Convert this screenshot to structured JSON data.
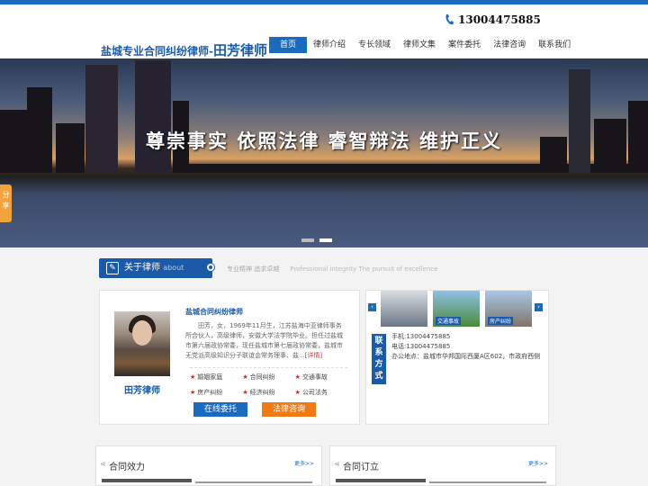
{
  "header": {
    "logo_text": "盐城专业合同纠纷律师-",
    "logo_name": "田芳律师",
    "phone": "13004475885"
  },
  "nav": {
    "items": [
      "首页",
      "律师介绍",
      "专长领域",
      "律师文集",
      "案件委托",
      "法律咨询",
      "联系我们"
    ],
    "active_index": 0
  },
  "banner": {
    "slogan": "尊崇事实  依照法律  睿智辩法  维护正义",
    "slide_count": 2,
    "active_slide": 1
  },
  "share": {
    "label": "分享"
  },
  "about": {
    "title": "关于律师",
    "title_en": "about",
    "motto": "专业精神 追求卓越",
    "motto_en": "Professional integrity The pursuit of excellence"
  },
  "lawyer": {
    "name": "田芳律师",
    "intro_title": "盐城合同纠纷律师",
    "intro_text": "田芳，女，1969年11月生，江苏盐海中亚律师事务所合伙人，高级律师，安徽大学法学院毕业。担任过盐城市第六届政协常委，现任盐城市第七届政协常委，盐城市无党派高级知识分子联谊会常务理事、盐...",
    "detail_link": "[详情]",
    "tags": [
      "婚姻家庭",
      "合同纠纷",
      "交通事故",
      "房产纠纷",
      "经济纠纷",
      "公司法务"
    ],
    "entrust_button": "在线委托",
    "consult_button": "法律咨询"
  },
  "contact": {
    "label": "联系方式",
    "thumbs": [
      "",
      "交通事故",
      "房产纠纷"
    ],
    "mobile": "手机:13004475885",
    "tel": "电话:13004475885",
    "address": "办公地点：盐城市华邦国际西厦A区602，市政府西侧"
  },
  "sections": [
    {
      "title": "合同效力",
      "more": "更多>>"
    },
    {
      "title": "合同订立",
      "more": "更多>>"
    }
  ]
}
